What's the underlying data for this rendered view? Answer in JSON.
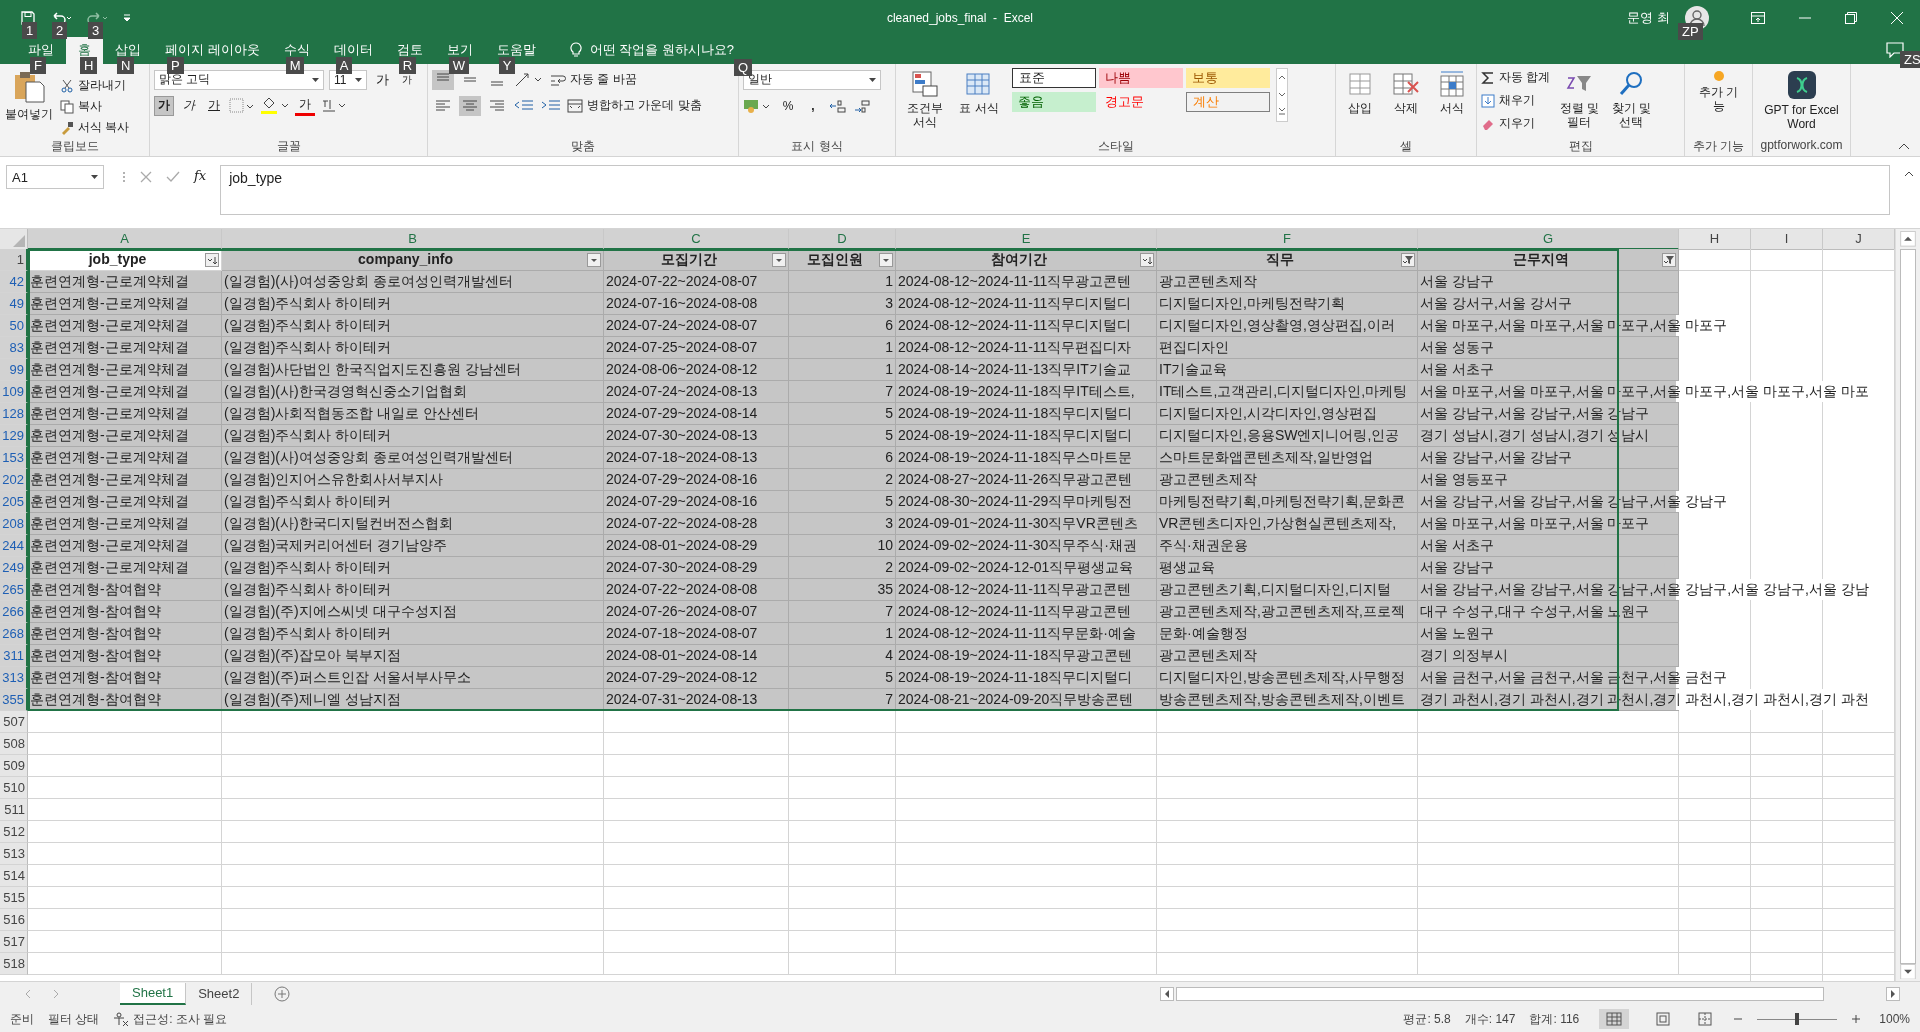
{
  "qat": [
    {
      "kind": "save",
      "keytip": "1"
    },
    {
      "kind": "undo",
      "keytip": "2"
    },
    {
      "kind": "redo",
      "keytip": "3"
    }
  ],
  "window": {
    "title": "cleaned_jobs_final  -  Excel",
    "user": "문영 최",
    "user_keytip": "ZP",
    "comment_keytip": "ZS"
  },
  "tabs": [
    {
      "label": "파일",
      "keytip": "F",
      "selected": false
    },
    {
      "label": "홈",
      "keytip": "H",
      "selected": true
    },
    {
      "label": "삽입",
      "keytip": "N",
      "selected": false
    },
    {
      "label": "페이지 레이아웃",
      "keytip": "P",
      "selected": false
    },
    {
      "label": "수식",
      "keytip": "M",
      "selected": false
    },
    {
      "label": "데이터",
      "keytip": "A",
      "selected": false
    },
    {
      "label": "검토",
      "keytip": "R",
      "selected": false
    },
    {
      "label": "보기",
      "keytip": "W",
      "selected": false
    },
    {
      "label": "도움말",
      "keytip": "Y",
      "selected": false
    }
  ],
  "tell_me": {
    "label": "어떤 작업을 원하시나요?",
    "keytip": "Q"
  },
  "ribbon": {
    "clipboard": {
      "title": "클립보드",
      "paste": "붙여넣기",
      "cut": "잘라내기",
      "copy": "복사",
      "format_painter": "서식 복사"
    },
    "font": {
      "title": "글꼴",
      "font_name": "맑은 고딕",
      "font_size": "11",
      "grow": "가",
      "shrink": "가",
      "bold": "가",
      "bold_on": true,
      "italic": "가",
      "underline": "가",
      "font_color": "가"
    },
    "alignment": {
      "title": "맞춤",
      "wrap": "자동 줄 바꿈",
      "merge": "병합하고 가운데 맞춤",
      "vertical": [
        {
          "kind": "top",
          "selected": true
        },
        {
          "kind": "middle",
          "selected": false
        },
        {
          "kind": "bottom",
          "selected": false
        }
      ],
      "horizontal": [
        {
          "kind": "left",
          "selected": false
        },
        {
          "kind": "center",
          "selected": true
        },
        {
          "kind": "right",
          "selected": false
        }
      ]
    },
    "number": {
      "title": "표시 형식",
      "format": "일반",
      "percent": "%",
      "comma": ","
    },
    "styles": {
      "title": "스타일",
      "conditional": "조건부 서식",
      "table": "표 서식",
      "cells": [
        {
          "label": "표준",
          "kind": "normal"
        },
        {
          "label": "나쁨",
          "kind": "bad"
        },
        {
          "label": "보통",
          "kind": "neutral"
        },
        {
          "label": "좋음",
          "kind": "good"
        },
        {
          "label": "경고문",
          "kind": "warning"
        },
        {
          "label": "계산",
          "kind": "calc"
        }
      ]
    },
    "cells": {
      "title": "셀",
      "insert": "삽입",
      "delete": "삭제",
      "format": "서식"
    },
    "editing": {
      "title": "편집",
      "autosum": "자동 합계",
      "fill": "채우기",
      "clear": "지우기",
      "sort": "정렬 및 필터",
      "find": "찾기 및 선택"
    },
    "addins": {
      "title": "추가 기능",
      "label": "추가 기능"
    },
    "gpt": {
      "title": "gptforwork.com",
      "label": "GPT for Excel Word"
    }
  },
  "formula_bar": {
    "name_box": "A1",
    "function_label": "fx",
    "formula": "job_type"
  },
  "sheet": {
    "columns": [
      {
        "letter": "A",
        "header": "job_type",
        "sorted": true,
        "filtered": false,
        "kind": "text"
      },
      {
        "letter": "B",
        "header": "company_info",
        "sorted": false,
        "filtered": false,
        "kind": "text"
      },
      {
        "letter": "C",
        "header": "모집기간",
        "sorted": false,
        "filtered": false,
        "kind": "text"
      },
      {
        "letter": "D",
        "header": "모집인원",
        "sorted": false,
        "filtered": false,
        "kind": "number"
      },
      {
        "letter": "E",
        "header": "참여기간",
        "sorted": true,
        "filtered": false,
        "kind": "text"
      },
      {
        "letter": "F",
        "header": "직무",
        "sorted": false,
        "filtered": true,
        "kind": "text"
      },
      {
        "letter": "G",
        "header": "근무지역",
        "sorted": false,
        "filtered": true,
        "kind": "text"
      },
      {
        "letter": "H"
      },
      {
        "letter": "I"
      },
      {
        "letter": "J"
      }
    ],
    "header_row": "1",
    "rows": [
      {
        "row": "42",
        "selected": true,
        "cells": [
          "훈련연계형-근로계약체결",
          "(일경험)(사)여성중앙회 종로여성인력개발센터",
          "2024-07-22~2024-08-07",
          "1",
          "2024-08-12~2024-11-11직무광고콘텐",
          "광고콘텐츠제작",
          "서울 강남구"
        ]
      },
      {
        "row": "49",
        "selected": true,
        "cells": [
          "훈련연계형-근로계약체결",
          "(일경험)주식회사 하이테커",
          "2024-07-16~2024-08-08",
          "3",
          "2024-08-12~2024-11-11직무디지털디",
          "디지털디자인,마케팅전략기획",
          "서울 강서구,서울 강서구"
        ]
      },
      {
        "row": "50",
        "selected": true,
        "cells": [
          "훈련연계형-근로계약체결",
          "(일경험)주식회사 하이테커",
          "2024-07-24~2024-08-07",
          "6",
          "2024-08-12~2024-11-11직무디지털디",
          "디지털디자인,영상촬영,영상편집,이러",
          "서울 마포구,서울 마포구,서울 마포구,서울 마포구"
        ]
      },
      {
        "row": "83",
        "selected": true,
        "cells": [
          "훈련연계형-근로계약체결",
          "(일경험)주식회사 하이테커",
          "2024-07-25~2024-08-07",
          "1",
          "2024-08-12~2024-11-11직무편집디자",
          "편집디자인",
          "서울 성동구"
        ]
      },
      {
        "row": "99",
        "selected": true,
        "cells": [
          "훈련연계형-근로계약체결",
          "(일경험)사단법인 한국직업지도진흥원 강남센터",
          "2024-08-06~2024-08-12",
          "1",
          "2024-08-14~2024-11-13직무IT기술교",
          "IT기술교육",
          "서울 서초구"
        ]
      },
      {
        "row": "109",
        "selected": true,
        "cells": [
          "훈련연계형-근로계약체결",
          "(일경험)(사)한국경영혁신중소기업협회",
          "2024-07-24~2024-08-13",
          "7",
          "2024-08-19~2024-11-18직무IT테스트,",
          "IT테스트,고객관리,디지털디자인,마케팅",
          "서울 마포구,서울 마포구,서울 마포구,서울 마포구,서울 마포구,서울 마포"
        ]
      },
      {
        "row": "128",
        "selected": true,
        "cells": [
          "훈련연계형-근로계약체결",
          "(일경험)사회적협동조합 내일로 안산센터",
          "2024-07-29~2024-08-14",
          "5",
          "2024-08-19~2024-11-18직무디지털디",
          "디지털디자인,시각디자인,영상편집",
          "서울 강남구,서울 강남구,서울 강남구"
        ]
      },
      {
        "row": "129",
        "selected": true,
        "cells": [
          "훈련연계형-근로계약체결",
          "(일경험)주식회사 하이테커",
          "2024-07-30~2024-08-13",
          "5",
          "2024-08-19~2024-11-18직무디지털디",
          "디지털디자인,응용SW엔지니어링,인공",
          "경기 성남시,경기 성남시,경기 성남시"
        ]
      },
      {
        "row": "153",
        "selected": true,
        "cells": [
          "훈련연계형-근로계약체결",
          "(일경험)(사)여성중앙회 종로여성인력개발센터",
          "2024-07-18~2024-08-13",
          "6",
          "2024-08-19~2024-11-18직무스마트문",
          "스마트문화앱콘텐츠제작,일반영업",
          "서울 강남구,서울 강남구"
        ]
      },
      {
        "row": "202",
        "selected": true,
        "cells": [
          "훈련연계형-근로계약체결",
          "(일경험)인지어스유한회사서부지사",
          "2024-07-29~2024-08-16",
          "2",
          "2024-08-27~2024-11-26직무광고콘텐",
          "광고콘텐츠제작",
          "서울 영등포구"
        ]
      },
      {
        "row": "205",
        "selected": true,
        "cells": [
          "훈련연계형-근로계약체결",
          "(일경험)주식회사 하이테커",
          "2024-07-29~2024-08-16",
          "5",
          "2024-08-30~2024-11-29직무마케팅전",
          "마케팅전략기획,마케팅전략기획,문화콘",
          "서울 강남구,서울 강남구,서울 강남구,서울 강남구"
        ]
      },
      {
        "row": "208",
        "selected": true,
        "cells": [
          "훈련연계형-근로계약체결",
          "(일경험)(사)한국디지털컨버전스협회",
          "2024-07-22~2024-08-28",
          "3",
          "2024-09-01~2024-11-30직무VR콘텐츠",
          "VR콘텐츠디자인,가상현실콘텐츠제작,",
          "서울 마포구,서울 마포구,서울 마포구"
        ]
      },
      {
        "row": "244",
        "selected": true,
        "cells": [
          "훈련연계형-근로계약체결",
          "(일경험)국제커리어센터 경기남양주",
          "2024-08-01~2024-08-29",
          "10",
          "2024-09-02~2024-11-30직무주식·채권",
          "주식·채권운용",
          "서울 서초구"
        ]
      },
      {
        "row": "249",
        "selected": true,
        "cells": [
          "훈련연계형-근로계약체결",
          "(일경험)주식회사 하이테커",
          "2024-07-30~2024-08-29",
          "2",
          "2024-09-02~2024-12-01직무평생교육",
          "평생교육",
          "서울 강남구"
        ]
      },
      {
        "row": "265",
        "selected": true,
        "cells": [
          "훈련연계형-참여협약",
          "(일경험)주식회사 하이테커",
          "2024-07-22~2024-08-08",
          "35",
          "2024-08-12~2024-11-11직무광고콘텐",
          "광고콘텐츠기획,디지털디자인,디지털",
          "서울 강남구,서울 강남구,서울 강남구,서울 강남구,서울 강남구,서울 강남"
        ]
      },
      {
        "row": "266",
        "selected": true,
        "cells": [
          "훈련연계형-참여협약",
          "(일경험)(주)지에스씨넷 대구수성지점",
          "2024-07-26~2024-08-07",
          "7",
          "2024-08-12~2024-11-11직무광고콘텐",
          "광고콘텐츠제작,광고콘텐츠제작,프로젝",
          "대구 수성구,대구 수성구,서울 노원구"
        ]
      },
      {
        "row": "268",
        "selected": true,
        "cells": [
          "훈련연계형-참여협약",
          "(일경험)주식회사 하이테커",
          "2024-07-18~2024-08-07",
          "1",
          "2024-08-12~2024-11-11직무문화·예술",
          "문화·예술행정",
          "서울 노원구"
        ]
      },
      {
        "row": "311",
        "selected": true,
        "cells": [
          "훈련연계형-참여협약",
          "(일경험)(주)잡모아 북부지점",
          "2024-08-01~2024-08-14",
          "4",
          "2024-08-19~2024-11-18직무광고콘텐",
          "광고콘텐츠제작",
          "경기 의정부시"
        ]
      },
      {
        "row": "313",
        "selected": true,
        "cells": [
          "훈련연계형-참여협약",
          "(일경험)(주)퍼스트인잡 서울서부사무소",
          "2024-07-29~2024-08-12",
          "5",
          "2024-08-19~2024-11-18직무디지털디",
          "디지털디자인,방송콘텐츠제작,사무행정",
          "서울 금천구,서울 금천구,서울 금천구,서울 금천구"
        ]
      },
      {
        "row": "355",
        "selected": true,
        "cells": [
          "훈련연계형-참여협약",
          "(일경험)(주)제니엘 성남지점",
          "2024-07-31~2024-08-13",
          "7",
          "2024-08-21~2024-09-20직무방송콘텐",
          "방송콘텐츠제작,방송콘텐츠제작,이벤트",
          "경기 과천시,경기 과천시,경기 과천시,경기 과천시,경기 과천시,경기 과천"
        ]
      },
      {
        "row": "507",
        "selected": false
      },
      {
        "row": "508",
        "selected": false
      },
      {
        "row": "509",
        "selected": false
      },
      {
        "row": "510",
        "selected": false
      },
      {
        "row": "511",
        "selected": false
      },
      {
        "row": "512",
        "selected": false
      },
      {
        "row": "513",
        "selected": false
      },
      {
        "row": "514",
        "selected": false
      },
      {
        "row": "515",
        "selected": false
      },
      {
        "row": "516",
        "selected": false
      },
      {
        "row": "517",
        "selected": false
      },
      {
        "row": "518",
        "selected": false
      }
    ]
  },
  "sheet_tabs": [
    {
      "label": "Sheet1",
      "selected": true
    },
    {
      "label": "Sheet2",
      "selected": false
    }
  ],
  "status_bar": {
    "ready": "준비",
    "filter": "필터 상태",
    "accessibility": "접근성: 조사 필요",
    "average": "평균: 5.8",
    "count": "개수: 147",
    "sum": "합계: 116",
    "zoom": "100%",
    "zoom_slider": {
      "level": 0.5
    }
  }
}
